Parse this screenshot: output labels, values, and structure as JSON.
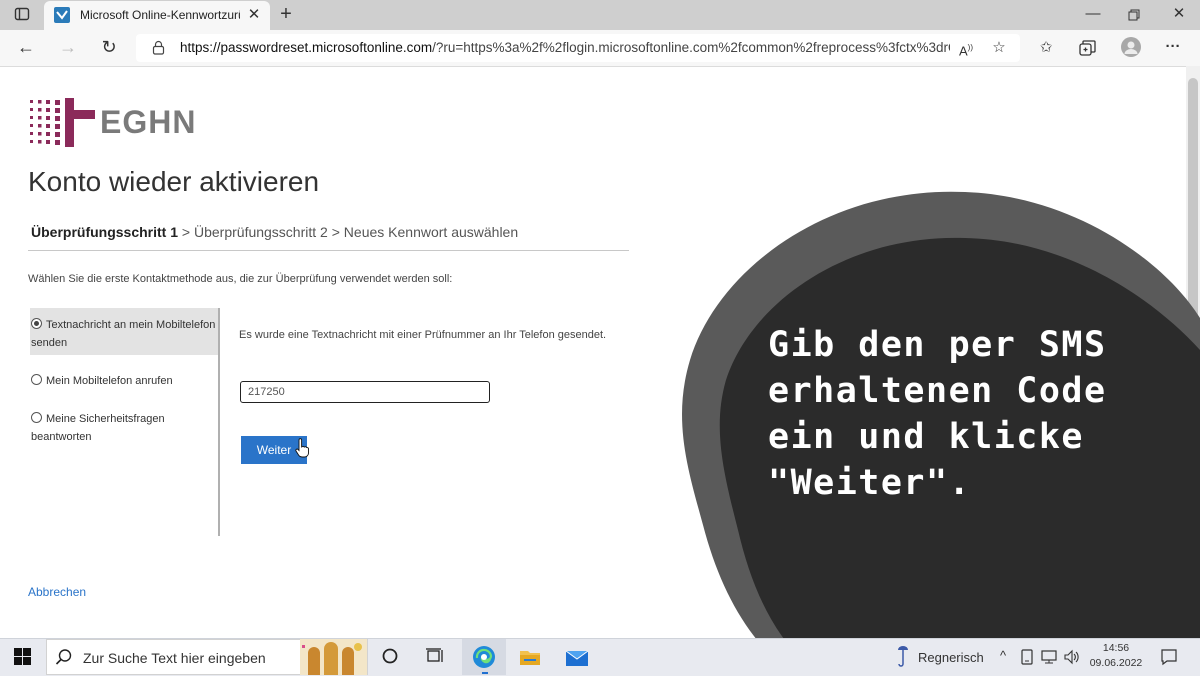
{
  "browser": {
    "tab_title": "Microsoft Online-Kennwortzurüc",
    "new_tab_icon": "+",
    "url_host": "https://passwordreset.microsoftonline.com",
    "url_rest": "/?ru=https%3a%2f%2flogin.microsoftonline.com%2fcommon%2freprocess%3fctx%3drQ..."
  },
  "page": {
    "logo_text": "EGHN",
    "title": "Konto wieder aktivieren",
    "steps": {
      "step1": "Überprüfungsschritt 1",
      "sep1": " > ",
      "step2": "Überprüfungsschritt 2",
      "sep2": " > ",
      "step3": "Neues Kennwort auswählen"
    },
    "instruction": "Wählen Sie die erste Kontaktmethode aus, die zur Überprüfung verwendet werden soll:",
    "methods": [
      {
        "label": "Textnachricht an mein Mobiltelefon senden",
        "selected": true
      },
      {
        "label": "Mein Mobiltelefon anrufen",
        "selected": false
      },
      {
        "label": "Meine Sicherheitsfragen beantworten",
        "selected": false
      }
    ],
    "sms_info": "Es wurde eine Textnachricht mit einer Prüfnummer an Ihr Telefon gesendet.",
    "code_value": "217250",
    "next_label": "Weiter",
    "cancel_label": "Abbrechen"
  },
  "overlay": {
    "lines": [
      "Gib den per SMS",
      "erhaltenen Code",
      "ein und klicke",
      "\"Weiter\"."
    ]
  },
  "taskbar": {
    "search_placeholder": "Zur Suche Text hier eingeben",
    "weather": "Regnerisch",
    "time": "14:56",
    "date": "09.06.2022"
  },
  "colors": {
    "accent": "#2a74c9",
    "logo_purple": "#8b2a5a",
    "overlay_outer": "#5a5a5a",
    "overlay_inner": "#2b2b2b"
  }
}
